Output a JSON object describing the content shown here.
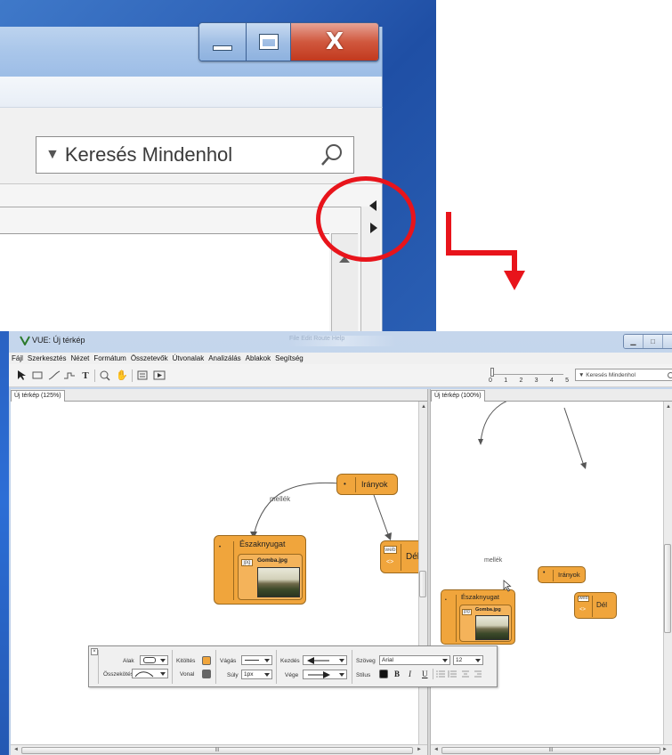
{
  "zoomed": {
    "search_placeholder": "Keresés Mindenhol",
    "minimize_glyph": "—",
    "close_glyph": "X"
  },
  "window": {
    "title": "VUE: Új térkép",
    "faded_menu": "File  Edit  Route  Help"
  },
  "menubar": [
    "Fájl",
    "Szerkesztés",
    "Nézet",
    "Formátum",
    "Összetevők",
    "Útvonalak",
    "Analizálás",
    "Ablakok",
    "Segítség"
  ],
  "toolbar": {
    "zoom_levels": [
      "0",
      "1",
      "2",
      "3",
      "4",
      "5"
    ],
    "search_placeholder": "Keresés Mindenhol"
  },
  "left_panel": {
    "tab_label": "Új térkép (125%)",
    "scroll_label": "III"
  },
  "right_panel": {
    "tab_label": "Új térkép (100%)",
    "scroll_label": "III"
  },
  "map": {
    "edge_label": "mellék",
    "nodes": {
      "iranyok": "Irányok",
      "eszaknyugat": "Északnyugat",
      "image_name": "Gomba.jpg",
      "image_chip": "jpg",
      "del": "Dél",
      "web_chip": "web",
      "web_icon": "<>",
      "pin_marker": "•"
    }
  },
  "format_toolbar": {
    "shape_label": "Alak",
    "connection_label": "Összekötés",
    "fill_label": "Kitöltés",
    "line_label": "Vonal",
    "stroke_label": "Vágás",
    "weight_label": "Súly",
    "weight_value": "1px",
    "start_label": "Kezdés",
    "end_label": "Vége",
    "text_label": "Szöveg",
    "font_value": "Arial",
    "size_value": "12",
    "style_label": "Stílus",
    "bold": "B",
    "italic": "I",
    "underline": "U",
    "fill_color": "#f0a53c",
    "line_color": "#666666"
  },
  "colors": {
    "node_fill": "#f0a53c",
    "node_border": "#9c6a1f",
    "highlight": "#e8141b"
  }
}
